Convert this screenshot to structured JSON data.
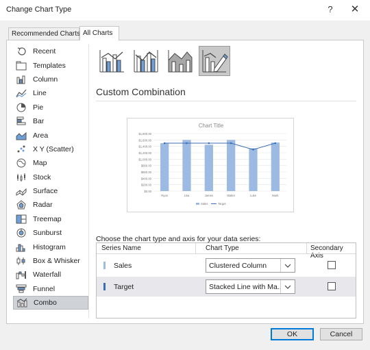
{
  "dialog": {
    "title": "Change Chart Type",
    "help_label": "?",
    "close_label": "✕"
  },
  "tabs": [
    {
      "label": "Recommended Charts",
      "active": false
    },
    {
      "label": "All Charts",
      "active": true
    }
  ],
  "sidebar": {
    "items": [
      {
        "label": "Recent",
        "icon": "recent-icon"
      },
      {
        "label": "Templates",
        "icon": "folder-icon"
      },
      {
        "label": "Column",
        "icon": "column-chart-icon"
      },
      {
        "label": "Line",
        "icon": "line-chart-icon"
      },
      {
        "label": "Pie",
        "icon": "pie-chart-icon"
      },
      {
        "label": "Bar",
        "icon": "bar-chart-icon"
      },
      {
        "label": "Area",
        "icon": "area-chart-icon"
      },
      {
        "label": "X Y (Scatter)",
        "icon": "scatter-chart-icon"
      },
      {
        "label": "Map",
        "icon": "map-chart-icon"
      },
      {
        "label": "Stock",
        "icon": "stock-chart-icon"
      },
      {
        "label": "Surface",
        "icon": "surface-chart-icon"
      },
      {
        "label": "Radar",
        "icon": "radar-chart-icon"
      },
      {
        "label": "Treemap",
        "icon": "treemap-chart-icon"
      },
      {
        "label": "Sunburst",
        "icon": "sunburst-chart-icon"
      },
      {
        "label": "Histogram",
        "icon": "histogram-chart-icon"
      },
      {
        "label": "Box & Whisker",
        "icon": "box-whisker-chart-icon"
      },
      {
        "label": "Waterfall",
        "icon": "waterfall-chart-icon"
      },
      {
        "label": "Funnel",
        "icon": "funnel-chart-icon"
      },
      {
        "label": "Combo",
        "icon": "combo-chart-icon"
      }
    ],
    "selected": "Combo"
  },
  "subtypes": [
    {
      "icon": "clustered-column-line-icon",
      "selected": false
    },
    {
      "icon": "clustered-column-line-secondary-axis-icon",
      "selected": false
    },
    {
      "icon": "stacked-area-clustered-column-icon",
      "selected": false
    },
    {
      "icon": "custom-combination-icon",
      "selected": true
    }
  ],
  "section_title": "Custom Combination",
  "preview": {
    "chart_data": {
      "type": "bar",
      "title": "Chart Title",
      "categories": [
        "Ryan",
        "Lisa",
        "James",
        "Walter",
        "Luke",
        "Mark"
      ],
      "y_ticks": [
        "$0.00",
        "$200.00",
        "$400.00",
        "$600.00",
        "$800.00",
        "$1,000.00",
        "$1,200.00",
        "$1,400.00",
        "$1,600.00",
        "$1,800.00"
      ],
      "ylim": [
        0,
        1800
      ],
      "series": [
        {
          "name": "Sales",
          "type": "column",
          "color": "#9dbbe2",
          "values": [
            1500,
            1600,
            1450,
            1600,
            1340,
            1520
          ]
        },
        {
          "name": "Target",
          "type": "line",
          "color": "#3b6db3",
          "values": [
            1500,
            1500,
            1500,
            1500,
            1300,
            1500
          ]
        }
      ],
      "legend": "bottom"
    }
  },
  "instructions": "Choose the chart type and axis for your data series:",
  "table": {
    "headers": {
      "series_name": "Series Name",
      "chart_type": "Chart Type",
      "secondary_axis": "Secondary Axis"
    },
    "rows": [
      {
        "name": "Sales",
        "swatch": "#9dbbe2",
        "chart_type": "Clustered Column",
        "secondary_axis": false
      },
      {
        "name": "Target",
        "swatch": "#3b6db3",
        "chart_type": "Stacked Line with Ma...",
        "secondary_axis": false
      }
    ]
  },
  "buttons": {
    "ok": "OK",
    "cancel": "Cancel"
  }
}
